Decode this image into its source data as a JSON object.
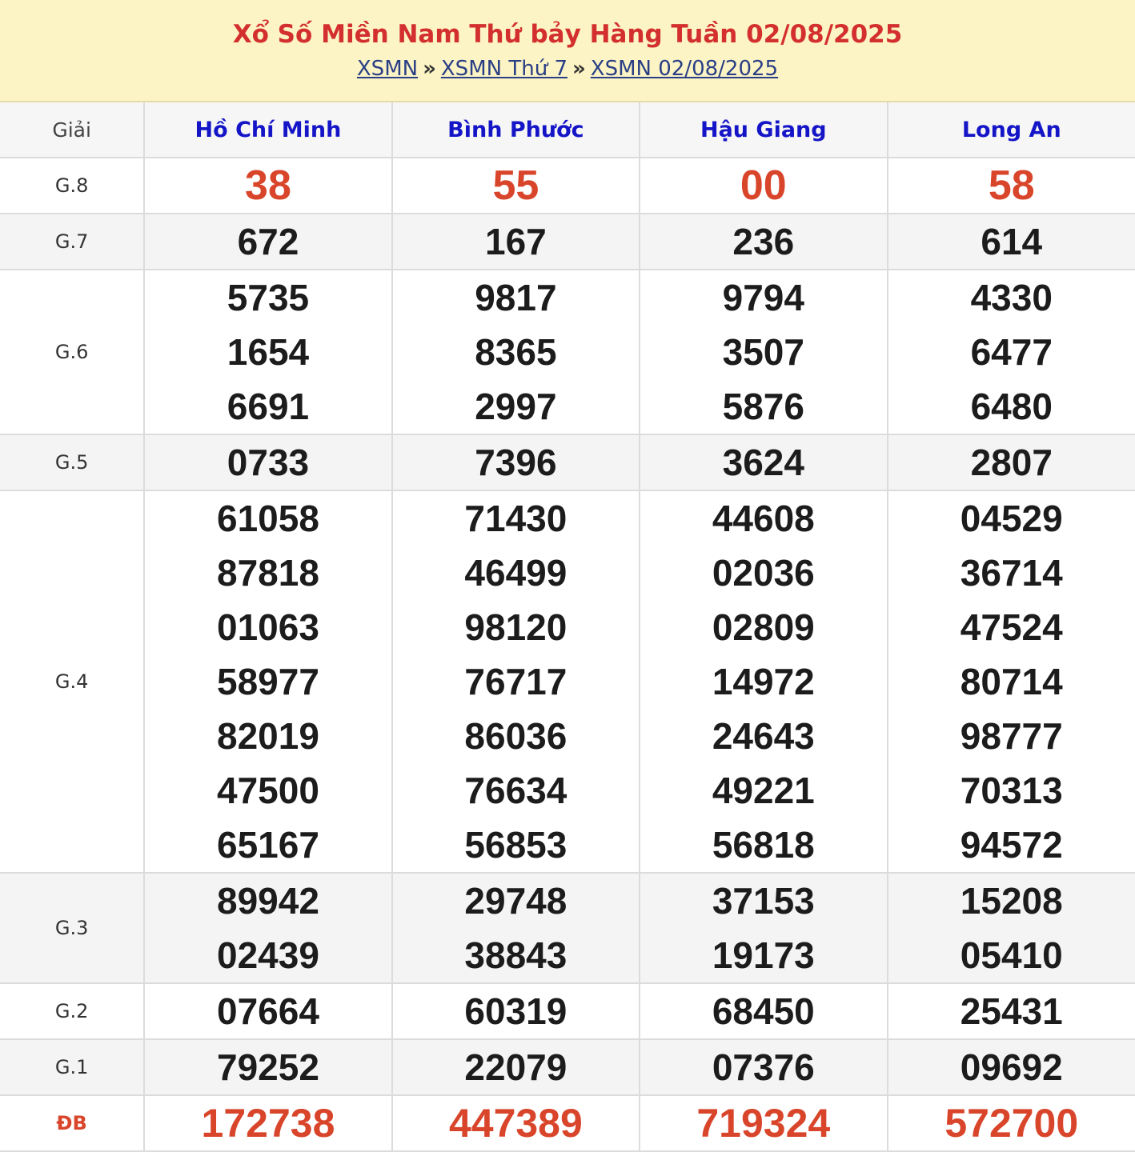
{
  "header": {
    "title": "Xổ Số Miền Nam Thứ bảy Hàng Tuần 02/08/2025",
    "breadcrumb": [
      "XSMN",
      "XSMN Thứ 7",
      "XSMN 02/08/2025"
    ],
    "separator": "»"
  },
  "table": {
    "label_header": "Giải",
    "provinces": [
      "Hồ Chí Minh",
      "Bình Phước",
      "Hậu Giang",
      "Long An"
    ],
    "rows": [
      {
        "label": "G.8",
        "values": [
          [
            "38"
          ],
          [
            "55"
          ],
          [
            "00"
          ],
          [
            "58"
          ]
        ]
      },
      {
        "label": "G.7",
        "values": [
          [
            "672"
          ],
          [
            "167"
          ],
          [
            "236"
          ],
          [
            "614"
          ]
        ]
      },
      {
        "label": "G.6",
        "values": [
          [
            "5735",
            "1654",
            "6691"
          ],
          [
            "9817",
            "8365",
            "2997"
          ],
          [
            "9794",
            "3507",
            "5876"
          ],
          [
            "4330",
            "6477",
            "6480"
          ]
        ]
      },
      {
        "label": "G.5",
        "values": [
          [
            "0733"
          ],
          [
            "7396"
          ],
          [
            "3624"
          ],
          [
            "2807"
          ]
        ]
      },
      {
        "label": "G.4",
        "values": [
          [
            "61058",
            "87818",
            "01063",
            "58977",
            "82019",
            "47500",
            "65167"
          ],
          [
            "71430",
            "46499",
            "98120",
            "76717",
            "86036",
            "76634",
            "56853"
          ],
          [
            "44608",
            "02036",
            "02809",
            "14972",
            "24643",
            "49221",
            "56818"
          ],
          [
            "04529",
            "36714",
            "47524",
            "80714",
            "98777",
            "70313",
            "94572"
          ]
        ]
      },
      {
        "label": "G.3",
        "values": [
          [
            "89942",
            "02439"
          ],
          [
            "29748",
            "38843"
          ],
          [
            "37153",
            "19173"
          ],
          [
            "15208",
            "05410"
          ]
        ]
      },
      {
        "label": "G.2",
        "values": [
          [
            "07664"
          ],
          [
            "60319"
          ],
          [
            "68450"
          ],
          [
            "25431"
          ]
        ]
      },
      {
        "label": "G.1",
        "values": [
          [
            "79252"
          ],
          [
            "22079"
          ],
          [
            "07376"
          ],
          [
            "09692"
          ]
        ]
      },
      {
        "label": "ĐB",
        "values": [
          [
            "172738"
          ],
          [
            "447389"
          ],
          [
            "719324"
          ],
          [
            "572700"
          ]
        ]
      }
    ]
  }
}
